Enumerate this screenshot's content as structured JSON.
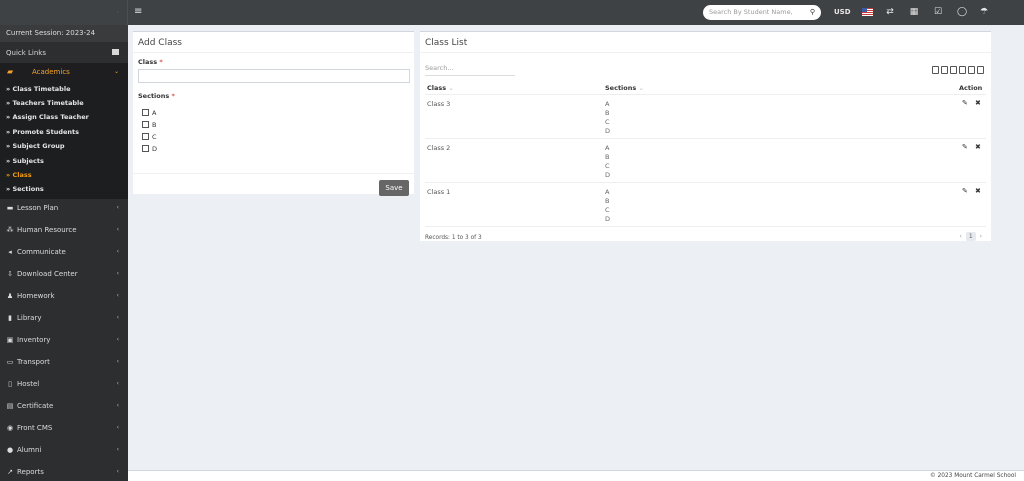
{
  "topbar": {
    "menu_icon": "hamburger-icon",
    "search_placeholder": "Search By Student Name,",
    "search_icon": "magnifier-icon",
    "currency": "USD",
    "icons": [
      "us-flag-icon",
      "swap-icon",
      "calendar-icon",
      "checkbox-icon",
      "whatsapp-icon",
      "umbrella-icon"
    ]
  },
  "sidebar": {
    "session": "Current Session: 2023-24",
    "quick_links": "Quick Links",
    "active_menu": "Academics",
    "submenu": [
      "» Class Timetable",
      "» Teachers Timetable",
      "» Assign Class Teacher",
      "» Promote Students",
      "» Subject Group",
      "» Subjects",
      "» Class",
      "» Sections"
    ],
    "active_submenu": "» Class",
    "items": [
      {
        "label": "Lesson Plan",
        "icon": "book-icon"
      },
      {
        "label": "Human Resource",
        "icon": "org-chart-icon"
      },
      {
        "label": "Communicate",
        "icon": "megaphone-icon"
      },
      {
        "label": "Download Center",
        "icon": "download-icon"
      },
      {
        "label": "Homework",
        "icon": "user-icon"
      },
      {
        "label": "Library",
        "icon": "library-book-icon"
      },
      {
        "label": "Inventory",
        "icon": "inventory-icon"
      },
      {
        "label": "Transport",
        "icon": "bus-icon"
      },
      {
        "label": "Hostel",
        "icon": "building-icon"
      },
      {
        "label": "Certificate",
        "icon": "certificate-icon"
      },
      {
        "label": "Front CMS",
        "icon": "globe-icon"
      },
      {
        "label": "Alumni",
        "icon": "alumni-icon"
      },
      {
        "label": "Reports",
        "icon": "chart-line-icon"
      }
    ]
  },
  "add_class": {
    "title": "Add Class",
    "class_label": "Class",
    "required_mark": "*",
    "class_value": "",
    "sections_label": "Sections",
    "sections": [
      "A",
      "B",
      "C",
      "D"
    ],
    "save_label": "Save"
  },
  "class_list": {
    "title": "Class List",
    "search_placeholder": "Search...",
    "toolbar_icons": [
      "copy-icon",
      "excel-icon",
      "csv-icon",
      "pdf-icon",
      "print-icon",
      "columns-icon"
    ],
    "columns": {
      "class": "Class",
      "sections": "Sections",
      "action": "Action"
    },
    "sort_glyph": "⌄",
    "rows": [
      {
        "class": "Class 3",
        "sections": [
          "A",
          "B",
          "C",
          "D"
        ]
      },
      {
        "class": "Class 2",
        "sections": [
          "A",
          "B",
          "C",
          "D"
        ]
      },
      {
        "class": "Class 1",
        "sections": [
          "A",
          "B",
          "C",
          "D"
        ]
      }
    ],
    "records": "Records: 1 to 3 of 3",
    "pagination": {
      "prev": "‹",
      "page": "1",
      "next": "›"
    }
  },
  "footer": {
    "text": "© 2023 Mount Carmel School"
  }
}
